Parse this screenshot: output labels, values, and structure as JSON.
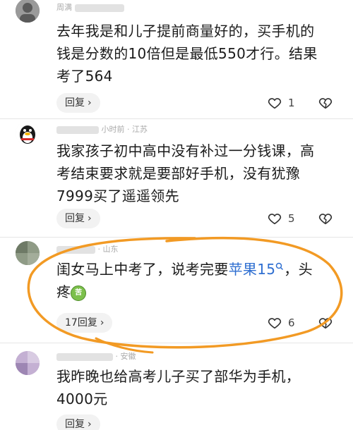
{
  "comments": [
    {
      "author": "周满",
      "meta": "",
      "text_lines": [
        "去年我是和儿子提前商量好的，买手机的",
        "钱是分数的10倍但是最低550才行。结果",
        "考了564"
      ],
      "reply_label": "回复",
      "likes": "1"
    },
    {
      "author": "",
      "meta": "小时前 · 江苏",
      "text_lines": [
        "我家孩子初中高中没有补过一分钱课，高",
        "考结束要求就是要部好手机，没有犹豫",
        "7999买了遥遥领先"
      ],
      "reply_label": "回复",
      "likes": "5"
    },
    {
      "author": "",
      "meta": "· 山东",
      "text_prefix": "闺女马上中考了，说考完要",
      "link_text": "苹果15",
      "text_suffix": "，头",
      "text_line2": "疼",
      "emoji": "苦",
      "reply_label": "17回复",
      "likes": "6"
    },
    {
      "author": "",
      "meta": "· 安徽",
      "text_lines": [
        "我昨晚也给高考儿子买了部华为手机，",
        "4000元"
      ],
      "reply_label": "回复"
    }
  ],
  "icons": {
    "like": "heart-outline-icon",
    "dislike": "broken-heart-icon",
    "search": "search-icon",
    "chevron": "chevron-right-icon"
  },
  "colors": {
    "link": "#2f6fd1",
    "annotation": "#f29a24",
    "reply_bg": "#f2f2f2"
  }
}
